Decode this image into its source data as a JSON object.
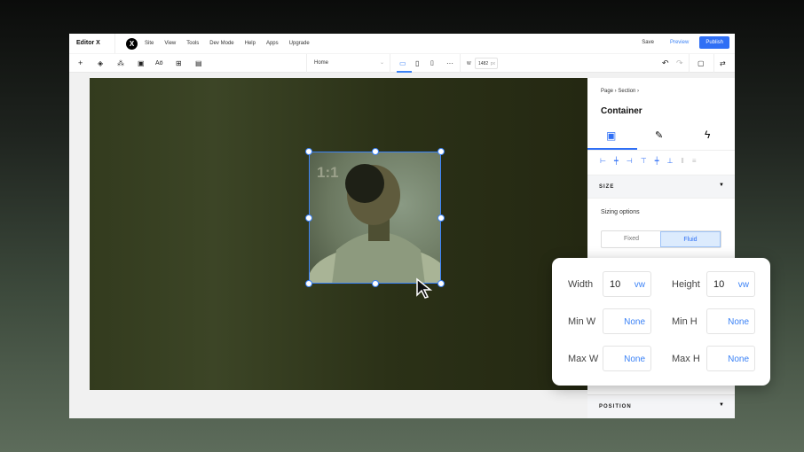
{
  "menubar": {
    "brand": "Editor X",
    "logo": "X",
    "items": [
      "Site",
      "View",
      "Tools",
      "Dev Mode",
      "Help",
      "Apps",
      "Upgrade"
    ],
    "save": "Save",
    "preview": "Preview",
    "publish": "Publish"
  },
  "toolbar": {
    "page": "Home",
    "width_label": "W",
    "width_value": "1482",
    "width_unit": "px"
  },
  "canvas": {
    "ratio": "1:1"
  },
  "panel": {
    "breadcrumb": [
      "Page",
      "Section"
    ],
    "title": "Container",
    "size_section": "SIZE",
    "sizing_label": "Sizing options",
    "fixed": "Fixed",
    "fluid": "Fluid",
    "position_section": "POSITION"
  },
  "popup": {
    "width_label": "Width",
    "width_value": "10",
    "width_unit": "vw",
    "height_label": "Height",
    "height_value": "10",
    "height_unit": "vw",
    "minw_label": "Min W",
    "minw_value": "None",
    "minh_label": "Min H",
    "minh_value": "None",
    "maxw_label": "Max W",
    "maxw_value": "None",
    "maxh_label": "Max H",
    "maxh_value": "None"
  },
  "colors": {
    "accent": "#2f6ff5"
  }
}
